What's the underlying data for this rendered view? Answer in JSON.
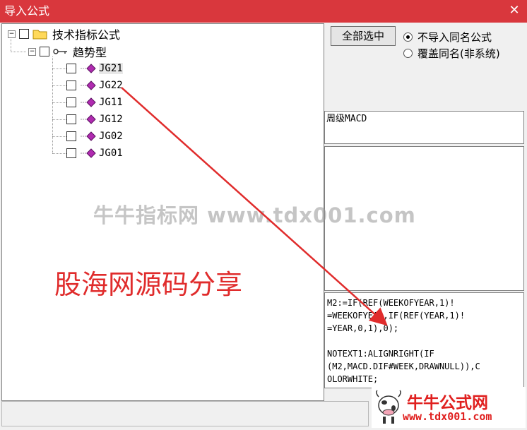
{
  "window": {
    "title": "导入公式",
    "close_glyph": "✕"
  },
  "tree": {
    "root_label": "技术指标公式",
    "group_label": "趋势型",
    "items": [
      "JG21",
      "JG22",
      "JG11",
      "JG12",
      "JG02",
      "JG01"
    ]
  },
  "buttons": {
    "select_all": "全部选中"
  },
  "radios": [
    {
      "label": "不导入同名公式",
      "selected": true
    },
    {
      "label": "覆盖同名(非系统)",
      "selected": false
    }
  ],
  "formula_name": "周级MACD",
  "formula_code": "M2:=IF(REF(WEEKOFYEAR,1)!\n=WEEKOFYEAR,IF(REF(YEAR,1)!\n=YEAR,0,1),0);\n\nNOTEXT1:ALIGNRIGHT(IF\n(M2,MACD.DIF#WEEK,DRAWNULL)),C\nOLORWHITE;",
  "overlay": {
    "watermark": "牛牛指标网 www.tdx001.com",
    "share_text": "股海网源码分享",
    "logo_main": "牛牛公式网",
    "logo_url": "www.tdx001.com"
  },
  "colors": {
    "titlebar": "#d9373d",
    "annotation": "#e02c2c"
  }
}
